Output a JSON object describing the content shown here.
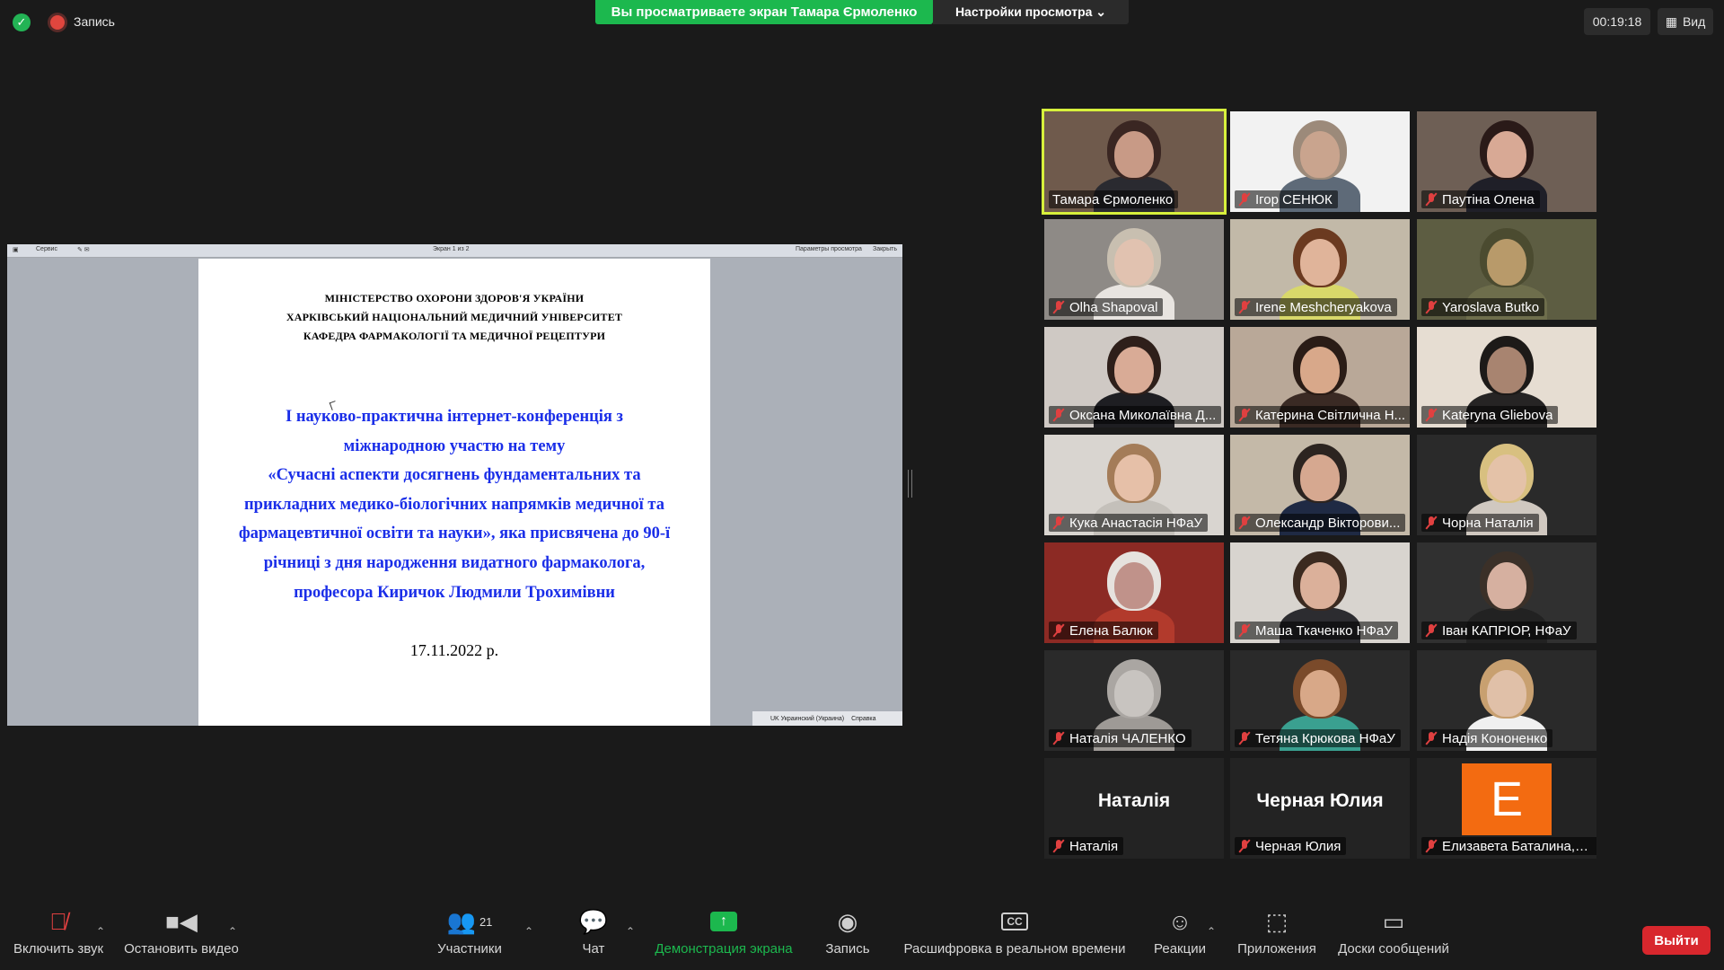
{
  "recording": {
    "label": "Запись"
  },
  "banner": {
    "viewing": "Вы просматриваете экран Тамара Єрмоленко",
    "view_options": "Настройки просмотра ⌄"
  },
  "timer": "00:19:18",
  "view_button": "Вид",
  "shared_doc": {
    "toolbar_left": "Сервис",
    "toolbar_center": "Экран 1 из 2",
    "toolbar_right": "Параметры просмотра",
    "toolbar_close": "Закрыть",
    "ministry_lines": [
      "МІНІСТЕРСТВО ОХОРОНИ ЗДОРОВ'Я УКРАЇНИ",
      "ХАРКІВСЬКИЙ НАЦІОНАЛЬНИЙ МЕДИЧНИЙ УНІВЕРСИТЕТ",
      "КАФЕДРА ФАРМАКОЛОГІЇ ТА МЕДИЧНОЇ РЕЦЕПТУРИ"
    ],
    "title_lines": [
      "І науково-практична інтернет-конференція з",
      "міжнародною участю на тему",
      "«Сучасні аспекти досягнень фундаментальних та",
      "прикладних медико-біологічних напрямків медичної та",
      "фармацевтичної освіти та науки», яка  присвячена до 90-ї",
      "річниці з дня народження видатного фармаколога,",
      "професора Киричок Людмили Трохимівни"
    ],
    "date": "17.11.2022 р.",
    "status_lang": "UK Украинский (Украина)",
    "status_help": "Справка"
  },
  "participants": [
    {
      "name": "Тамара Єрмоленко",
      "muted": false,
      "active": true,
      "bg": "#6f5a4c",
      "skin": "#c89a86",
      "hair": "#3a2622",
      "shirt": "#2a2a30"
    },
    {
      "name": "Ігор СЕНЮК",
      "muted": true,
      "bg": "#f2f2f2",
      "skin": "#c9a48e",
      "hair": "#9c8a7a",
      "shirt": "#5e6a78"
    },
    {
      "name": "Паутіна Олена",
      "muted": true,
      "bg": "#6e5f55",
      "skin": "#d8a995",
      "hair": "#2a1a18",
      "shirt": "#1f1f28"
    },
    {
      "name": "Olha Shapoval",
      "muted": true,
      "bg": "#8e8a86",
      "skin": "#e1c2b0",
      "hair": "#c8bfb0",
      "shirt": "#e8e4e0"
    },
    {
      "name": "Irene Meshcheryakova",
      "muted": true,
      "bg": "#c2b9a8",
      "skin": "#e0b49a",
      "hair": "#6b3a20",
      "shirt": "#d8d86a"
    },
    {
      "name": "Yaroslava Butko",
      "muted": true,
      "bg": "#5d5d42",
      "skin": "#b89a6a",
      "hair": "#4b4b30",
      "shirt": "#6e6e4c"
    },
    {
      "name": "Оксана Миколаївна Д...",
      "muted": true,
      "bg": "#cfc9c4",
      "skin": "#d9ab96",
      "hair": "#2e1f1a",
      "shirt": "#1e1e22"
    },
    {
      "name": "Катерина Світлична Н...",
      "muted": true,
      "bg": "#b9a898",
      "skin": "#d8a88a",
      "hair": "#2a1c16",
      "shirt": "#3a2a24"
    },
    {
      "name": "Kateryna Gliebova",
      "muted": true,
      "bg": "#e6ddd2",
      "skin": "#a88470",
      "hair": "#1d1a18",
      "shirt": "#262424"
    },
    {
      "name": "Кука Анастасія НФаУ",
      "muted": true,
      "bg": "#d9d5d0",
      "skin": "#e6c0a8",
      "hair": "#a47c58",
      "shirt": "#c4c0ba"
    },
    {
      "name": "Олександр Вікторови...",
      "muted": true,
      "bg": "#c4b9a8",
      "skin": "#d6a890",
      "hair": "#2c2420",
      "shirt": "#1f2a44"
    },
    {
      "name": "Чорна Наталія",
      "muted": true,
      "bg": "#2a2a2a",
      "skin": "#e4c2a8",
      "hair": "#d8c080",
      "shirt": "#d0c8c0"
    },
    {
      "name": "Елена Балюк",
      "muted": true,
      "bg": "#8c2a24",
      "skin": "#c0928a",
      "hair": "#e6e2de",
      "shirt": "#b23a2c"
    },
    {
      "name": "Маша Ткаченко НФаУ",
      "muted": true,
      "bg": "#d8d4cf",
      "skin": "#dbb09a",
      "hair": "#3b2a20",
      "shirt": "#2c2c30"
    },
    {
      "name": "Іван КАПРІОР, НФаУ",
      "muted": true,
      "bg": "#303030",
      "skin": "#d6b0a0",
      "hair": "#3b3028",
      "shirt": "#222222"
    },
    {
      "name": "Наталія ЧАЛЕНКО",
      "muted": true,
      "bg": "#2a2a2a",
      "skin": "#c8c4c0",
      "hair": "#aaa6a2",
      "shirt": "#9e9a96"
    },
    {
      "name": "Тетяна Крюкова НФаУ",
      "muted": true,
      "bg": "#2a2a2a",
      "skin": "#d8a888",
      "hair": "#7a4a2a",
      "shirt": "#3aa090"
    },
    {
      "name": "Надія Кононенко",
      "muted": true,
      "bg": "#2a2a2a",
      "skin": "#e0c0a8",
      "hair": "#c8a070",
      "shirt": "#f0f0f0"
    },
    {
      "name": "Наталія",
      "muted": true,
      "display": "Наталія"
    },
    {
      "name": "Черная Юлия",
      "muted": true,
      "display": "Черная Юлия"
    },
    {
      "name": "Елизавета Баталина,Н...",
      "muted": true,
      "avatar_letter": "E",
      "avatar_color": "#f36b11"
    }
  ],
  "toolbar": {
    "unmute": "Включить звук",
    "stop_video": "Остановить видео",
    "participants": "Участники",
    "participants_count": "21",
    "chat": "Чат",
    "share": "Демонстрация экрана",
    "record": "Запись",
    "captions": "Расшифровка в реальном времени",
    "reactions": "Реакции",
    "apps": "Приложения",
    "whiteboards": "Доски сообщений",
    "leave": "Выйти"
  },
  "colors": {
    "share_green": "#1cb84e",
    "leave_red": "#d8272d",
    "active_speaker": "#d7f03c"
  }
}
